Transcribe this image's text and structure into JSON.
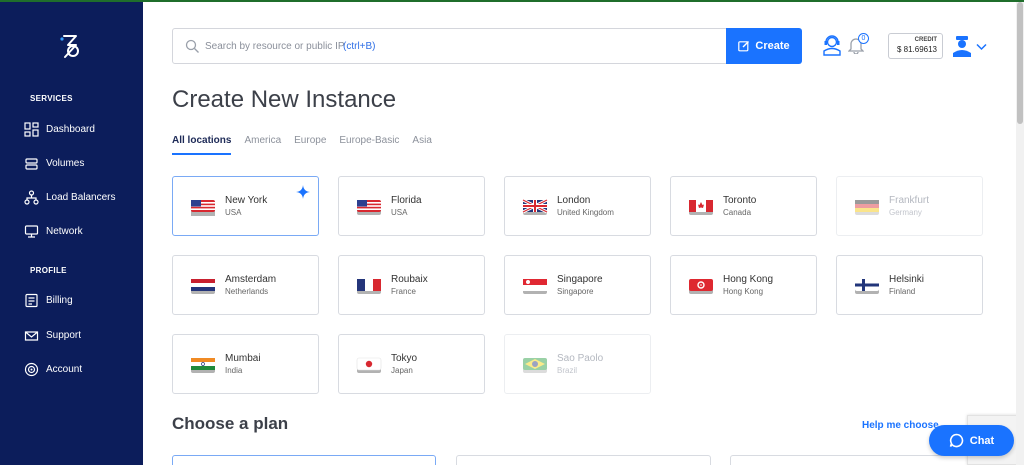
{
  "sidebar": {
    "logo_icon": "stack-logo-icon",
    "sections": [
      {
        "label": "SERVICES"
      },
      {
        "label": "PROFILE"
      }
    ],
    "items": [
      {
        "label": "Dashboard",
        "icon": "dashboard-icon"
      },
      {
        "label": "Volumes",
        "icon": "volumes-icon"
      },
      {
        "label": "Load Balancers",
        "icon": "load-balancer-icon"
      },
      {
        "label": "Network",
        "icon": "network-icon"
      },
      {
        "label": "Billing",
        "icon": "billing-icon"
      },
      {
        "label": "Support",
        "icon": "support-icon"
      },
      {
        "label": "Account",
        "icon": "account-icon"
      }
    ]
  },
  "header": {
    "search_placeholder": "Search by resource or public IP",
    "search_hint": "(ctrl+B)",
    "search_value": "",
    "create_label": "Create",
    "notification_count": "0",
    "credit_label": "CREDIT",
    "credit_value": "$ 81.69613"
  },
  "main": {
    "title": "Create New Instance",
    "tabs": [
      {
        "label": "All locations",
        "active": true
      },
      {
        "label": "America",
        "active": false
      },
      {
        "label": "Europe",
        "active": false
      },
      {
        "label": "Europe-Basic",
        "active": false
      },
      {
        "label": "Asia",
        "active": false
      }
    ],
    "locations": [
      {
        "city": "New York",
        "country": "USA",
        "flag": "usa-flag-icon",
        "selected": true,
        "disabled": false
      },
      {
        "city": "Florida",
        "country": "USA",
        "flag": "usa-flag-icon",
        "selected": false,
        "disabled": false
      },
      {
        "city": "London",
        "country": "United Kingdom",
        "flag": "uk-flag-icon",
        "selected": false,
        "disabled": false
      },
      {
        "city": "Toronto",
        "country": "Canada",
        "flag": "canada-flag-icon",
        "selected": false,
        "disabled": false
      },
      {
        "city": "Frankfurt",
        "country": "Germany",
        "flag": "germany-flag-icon",
        "selected": false,
        "disabled": true
      },
      {
        "city": "Amsterdam",
        "country": "Netherlands",
        "flag": "netherlands-flag-icon",
        "selected": false,
        "disabled": false
      },
      {
        "city": "Roubaix",
        "country": "France",
        "flag": "france-flag-icon",
        "selected": false,
        "disabled": false
      },
      {
        "city": "Singapore",
        "country": "Singapore",
        "flag": "singapore-flag-icon",
        "selected": false,
        "disabled": false
      },
      {
        "city": "Hong Kong",
        "country": "Hong Kong",
        "flag": "hong-kong-flag-icon",
        "selected": false,
        "disabled": false
      },
      {
        "city": "Helsinki",
        "country": "Finland",
        "flag": "finland-flag-icon",
        "selected": false,
        "disabled": false
      },
      {
        "city": "Mumbai",
        "country": "India",
        "flag": "india-flag-icon",
        "selected": false,
        "disabled": false
      },
      {
        "city": "Tokyo",
        "country": "Japan",
        "flag": "japan-flag-icon",
        "selected": false,
        "disabled": false
      },
      {
        "city": "Sao Paolo",
        "country": "Brazil",
        "flag": "brazil-flag-icon",
        "selected": false,
        "disabled": true
      }
    ],
    "plan_title": "Choose a plan",
    "help_link": "Help me choose",
    "chat_label": "Chat"
  },
  "colors": {
    "sidebar_bg": "#0c1d5b",
    "accent": "#1a73ff",
    "title_text": "#3c4049"
  }
}
